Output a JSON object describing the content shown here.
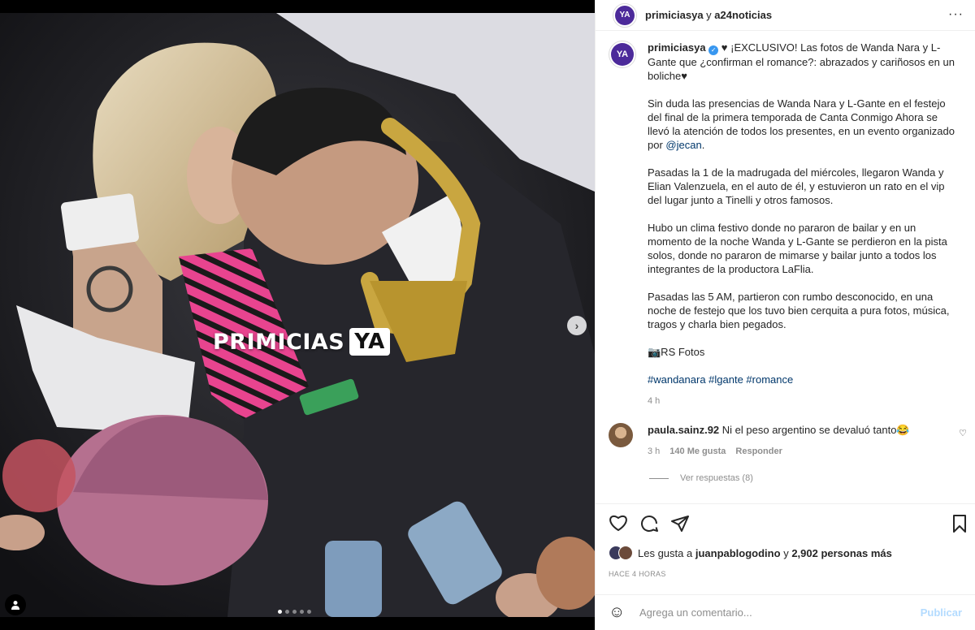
{
  "media": {
    "watermark_text": "PRIMICIAS",
    "watermark_badge": "YA",
    "carousel_total": 5,
    "carousel_active": 1,
    "icons": [
      "chevron-right-icon",
      "user-tag-icon"
    ]
  },
  "header": {
    "avatar_text": "YA",
    "username": "primiciasya",
    "connector": "y",
    "collaborator": "a24noticias",
    "more": "···"
  },
  "caption": {
    "username": "primiciasya",
    "lead": "♥ ¡EXCLUSIVO! Las fotos de Wanda Nara y L-Gante que ¿confirman el romance?: abrazados y cariñosos en un boliche♥",
    "p1_before": "Sin duda las presencias de Wanda Nara y L-Gante en el festejo del final de la primera temporada de Canta Conmigo Ahora se llevó la atención de todos los presentes, en un evento organizado por ",
    "p1_mention": "@jecan",
    "p1_after": ".",
    "p2": "Pasadas la 1 de la madrugada del miércoles, llegaron Wanda y Elian Valenzuela, en el auto de él, y estuvieron un rato en el vip del lugar junto a Tinelli y otros famosos.",
    "p3": "Hubo un clima festivo donde no pararon de bailar y en un momento de la noche Wanda y L-Gante se perdieron en la pista solos, donde no pararon de mimarse y bailar junto a todos los integrantes de la productora LaFlia.",
    "p4": "Pasadas las 5 AM, partieron con rumbo desconocido, en una noche de festejo que los tuvo bien cerquita a pura fotos, música, tragos y charla bien pegados.",
    "p5": "📷RS Fotos",
    "hashtags": "#wandanara #lgante #romance",
    "time": "4 h"
  },
  "comment": {
    "username": "paula.sainz.92",
    "text": "Ni el peso argentino se devaluó tanto😂",
    "time": "3 h",
    "likes": "140 Me gusta",
    "reply": "Responder",
    "view_replies": "Ver respuestas (8)"
  },
  "likes": {
    "prefix": "Les gusta a",
    "user": "juanpablogodino",
    "connector": "y",
    "count": "2,902 personas más"
  },
  "posted": "HACE 4 HORAS",
  "add_comment": {
    "placeholder": "Agrega un comentario...",
    "publish": "Publicar"
  },
  "colors": {
    "brand": "#4c2a9a",
    "link": "#00376b",
    "publish_disabled": "#b3dbff",
    "muted": "#8e8e8e"
  }
}
